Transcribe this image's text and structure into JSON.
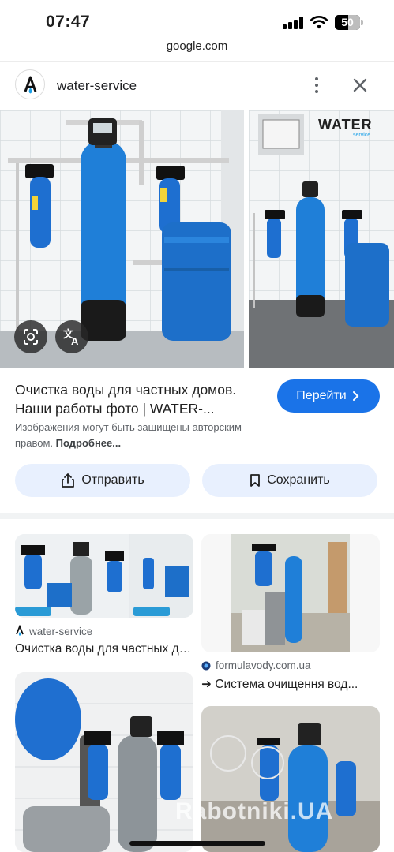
{
  "status_bar": {
    "time": "07:47",
    "battery": "50"
  },
  "url_bar": {
    "domain": "google.com"
  },
  "site_header": {
    "site_name": "water-service"
  },
  "main_image": {
    "brand_text": "WATER",
    "brand_sub": "service"
  },
  "result": {
    "title": "Очистка воды для частных домов. Наши работы фото | WATER-...",
    "visit_label": "Перейти",
    "copyright_text": "Изображения могут быть защищены авторским правом.",
    "copyright_more": "Подробнее..."
  },
  "actions": {
    "share_label": "Отправить",
    "save_label": "Сохранить"
  },
  "related": [
    {
      "source": "water-service",
      "title": "Очистка воды для частных домов..."
    },
    {
      "source": "formulavody.com.ua",
      "title": "➜ Система очищення вод..."
    }
  ],
  "watermark": "Rabotniki.UA",
  "colors": {
    "accent": "#1a73e8",
    "pill_bg": "#e8f0fe",
    "filter_blue": "#1e6fd0"
  },
  "icons": [
    "signal-icon",
    "wifi-icon",
    "more-vert-icon",
    "close-icon",
    "lens-icon",
    "translate-icon",
    "chevron-right-icon",
    "share-icon",
    "bookmark-icon"
  ]
}
